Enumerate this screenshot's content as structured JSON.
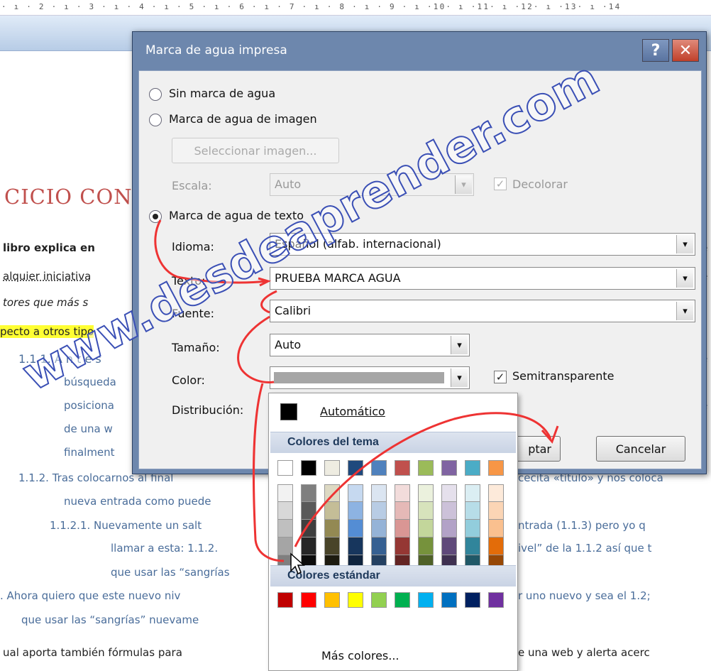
{
  "ruler": {
    "text": "· ı · 2 · ı · 3 · ı · 4 · ı · 5 · ı · 6 · ı · 7 · ı · 8 · ı · 9 · ı ·10· ı ·11· ı ·12· ı ·13· ı ·14"
  },
  "document": {
    "heading": "CICIO CON",
    "lines": [
      "libro explica en",
      "alquier iniciativa",
      "tores que más s",
      "pecto a otros tipo",
      "1.1.1. A n t e s",
      "búsqueda",
      "posiciona",
      "de una w",
      "finalment",
      "1.1.2. Tras colocarnos al final",
      "nueva entrada como puede",
      "1.1.2.1. Nuevamente un salt",
      "llamar a esta: 1.1.2.",
      "que usar las “sangrías",
      ". Ahora quiero que este nuevo niv",
      "que usar las “sangrías” nuevame",
      "ual aporta también fórmulas para"
    ],
    "right_lines": [
      "cecita «título» y nos coloca",
      "ntrada (1.1.3) pero yo q",
      "ivel” de la 1.1.2 así que t",
      "r uno nuevo y sea el 1.2;",
      "e una web y alerta acerc"
    ],
    "right_edge": [
      "e",
      "e",
      "e",
      "e"
    ]
  },
  "watermark": {
    "text": "www.desdeaprender.com"
  },
  "dialog": {
    "title": "Marca de agua impresa",
    "help": "?",
    "close": "✕",
    "options": {
      "none": "Sin marca de agua",
      "image": "Marca de agua de imagen",
      "text": "Marca de agua de texto"
    },
    "select_image": "Seleccionar imagen...",
    "scale_label": "Escala:",
    "scale_value": "Auto",
    "washout": "Decolorar",
    "language_label": "Idioma:",
    "language_value": "Español (alfab. internacional)",
    "text_label": "Texto:",
    "text_value": "PRUEBA MARCA AGUA",
    "font_label": "Fuente:",
    "font_value": "Calibri",
    "size_label": "Tamaño:",
    "size_value": "Auto",
    "color_label": "Color:",
    "semitransparent": "Semitransparente",
    "layout_label": "Distribución:",
    "ok": "ptar",
    "cancel": "Cancelar"
  },
  "color_menu": {
    "automatic": "Automático",
    "theme_header": "Colores del tema",
    "standard_header": "Colores estándar",
    "more": "Más colores...",
    "theme_top": [
      "#ffffff",
      "#000000",
      "#eeece1",
      "#1f497d",
      "#4f81bd",
      "#c0504d",
      "#9bbb59",
      "#8064a2",
      "#4bacc6",
      "#f79646"
    ],
    "theme_shades": [
      [
        "#f2f2f2",
        "#d8d8d8",
        "#bfbfbf",
        "#a5a5a5",
        "#7f7f7f"
      ],
      [
        "#7f7f7f",
        "#595959",
        "#3f3f3f",
        "#262626",
        "#0c0c0c"
      ],
      [
        "#ddd9c3",
        "#c4bd97",
        "#938953",
        "#494429",
        "#1d1b10"
      ],
      [
        "#c6d9f0",
        "#8db3e2",
        "#548dd4",
        "#17365d",
        "#0f243e"
      ],
      [
        "#dbe5f1",
        "#b8cce4",
        "#95b3d7",
        "#366092",
        "#244061"
      ],
      [
        "#f2dcdb",
        "#e5b9b7",
        "#d99694",
        "#953734",
        "#632423"
      ],
      [
        "#ebf1dd",
        "#d7e3bc",
        "#c3d69b",
        "#76923c",
        "#4f6128"
      ],
      [
        "#e5e0ec",
        "#ccc1d9",
        "#b2a2c7",
        "#5f497a",
        "#3f3151"
      ],
      [
        "#dbeef3",
        "#b7dde8",
        "#92cddc",
        "#31859b",
        "#205867"
      ],
      [
        "#fdeada",
        "#fbd5b5",
        "#fac08f",
        "#e36c09",
        "#974806"
      ]
    ],
    "standard": [
      "#c00000",
      "#ff0000",
      "#ffc000",
      "#ffff00",
      "#92d050",
      "#00b050",
      "#00b0f0",
      "#0070c0",
      "#002060",
      "#7030a0"
    ]
  }
}
